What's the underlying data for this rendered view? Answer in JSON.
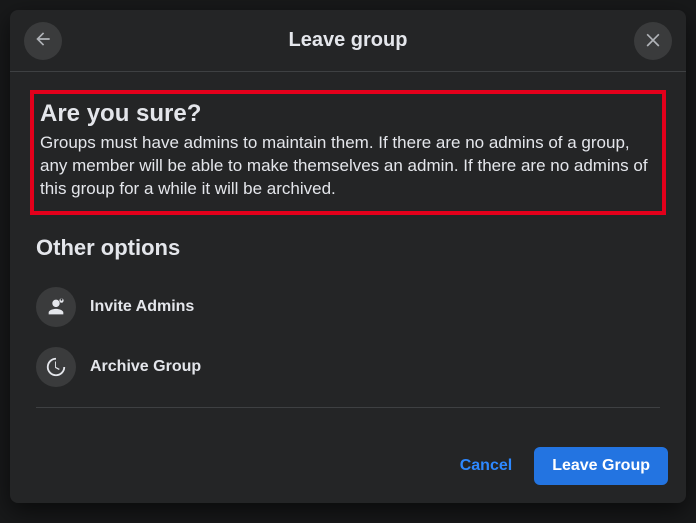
{
  "header": {
    "title": "Leave group"
  },
  "warning": {
    "title": "Are you sure?",
    "body": "Groups must have admins to maintain them. If there are no admins of a group, any member will be able to make themselves an admin. If there are no admins of this group for a while it will be archived."
  },
  "other_options": {
    "title": "Other options",
    "items": [
      {
        "label": "Invite Admins"
      },
      {
        "label": "Archive Group"
      }
    ]
  },
  "footer": {
    "cancel": "Cancel",
    "confirm": "Leave Group"
  }
}
